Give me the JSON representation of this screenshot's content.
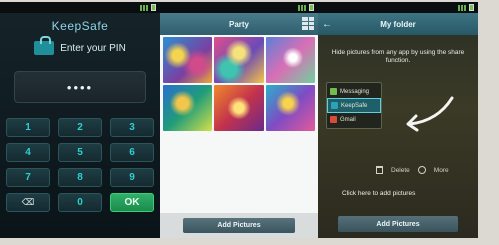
{
  "pin_screen": {
    "app_name": "KeepSafe",
    "prompt": "Enter your PIN",
    "pin_value": "••••",
    "keys": [
      "1",
      "2",
      "3",
      "4",
      "5",
      "6",
      "7",
      "8",
      "9",
      "⌫",
      "0",
      "OK"
    ]
  },
  "gallery_screen": {
    "title": "Party",
    "add_button": "Add Pictures"
  },
  "folder_screen": {
    "title": "My folder",
    "back_icon": "←",
    "info_text": "Hide pictures from any app by using the share function.",
    "share_options": [
      "Messaging",
      "KeepSafe",
      "Gmail"
    ],
    "delete_label": "Delete",
    "more_label": "More",
    "hint_text": "Click here to add pictures",
    "add_button": "Add Pictures"
  }
}
